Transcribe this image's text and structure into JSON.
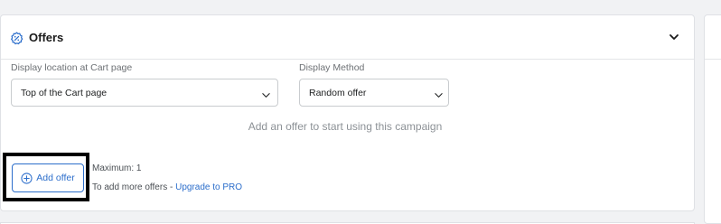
{
  "offers_card": {
    "title": "Offers",
    "header_icon": "offer-badge-icon",
    "collapse_icon": "chevron-down-icon"
  },
  "display_location": {
    "label": "Display location at Cart page",
    "value": "Top of the Cart page"
  },
  "display_method": {
    "label": "Display Method",
    "value": "Random offer"
  },
  "empty_state": {
    "message": "Add an offer to start using this campaign"
  },
  "add_offer": {
    "label": "Add offer",
    "icon": "plus-circle-icon"
  },
  "limits": {
    "maximum": "Maximum: 1",
    "more_offers_prefix": "To add more offers - ",
    "upgrade_link": "Upgrade to PRO"
  },
  "colors": {
    "accent": "#2c6ecb",
    "highlight_border": "#000000"
  }
}
